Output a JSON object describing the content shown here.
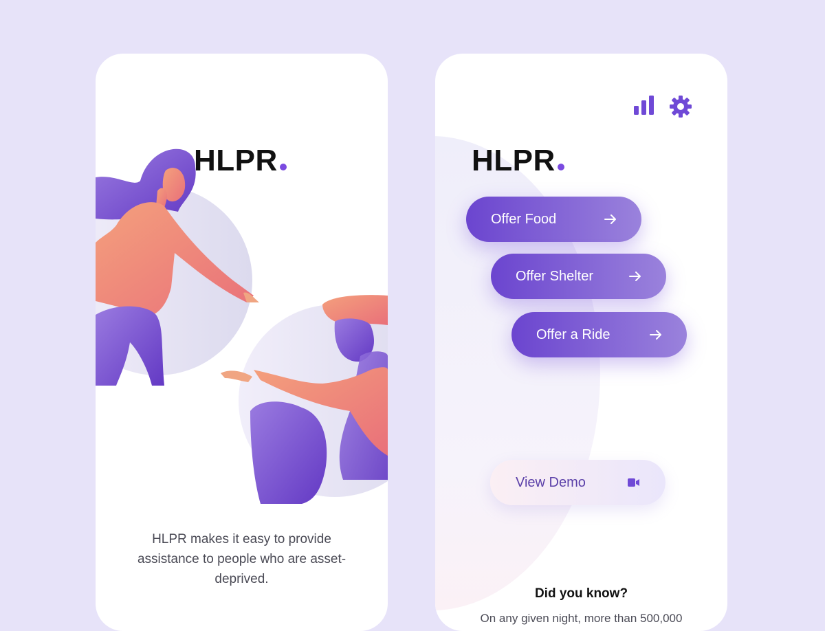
{
  "onboarding": {
    "logo": "HLPR",
    "tagline": "HLPR makes it easy to provide assistance to people who are asset-deprived."
  },
  "home": {
    "logo": "HLPR",
    "icons": [
      "bar-chart-icon",
      "gear-icon",
      "arrow-right-icon",
      "video-camera-icon"
    ],
    "actions": [
      {
        "label": "Offer Food"
      },
      {
        "label": "Offer Shelter"
      },
      {
        "label": "Offer a Ride"
      }
    ],
    "demo_label": "View Demo",
    "did_you_know": {
      "title": "Did you know?",
      "text": "On any given night, more than 500,000"
    }
  },
  "colors": {
    "background": "#e7e3f9",
    "accent": "#7a4ae0",
    "button_gradient_start": "#6b45cf",
    "button_gradient_end": "#9a82dc"
  }
}
